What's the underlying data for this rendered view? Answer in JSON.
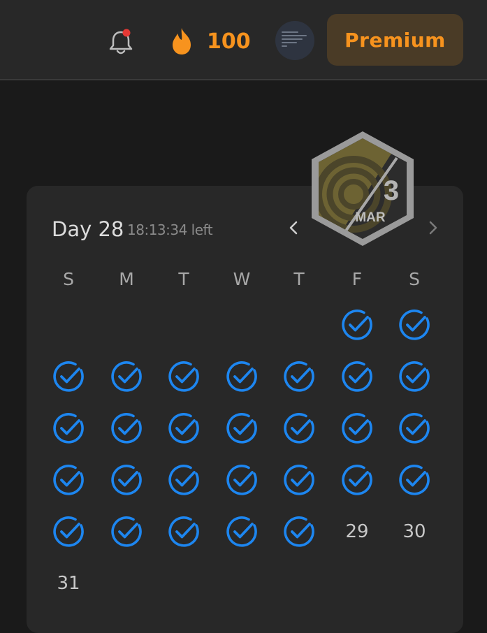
{
  "header": {
    "notification_icon": "bell-icon",
    "streak_icon": "flame-icon",
    "streak_count": "100",
    "premium_label": "Premium",
    "colors": {
      "accent": "#f7931e",
      "premium_bg": "#4a3b26"
    }
  },
  "calendar": {
    "day_label": "Day 28",
    "time_left": "18:13:34 left",
    "badge": {
      "day": "3",
      "month": "MAR"
    },
    "weekdays": [
      "S",
      "M",
      "T",
      "W",
      "T",
      "F",
      "S"
    ],
    "check_color": "#1d86f0",
    "days": [
      {
        "date": 1,
        "done": true
      },
      {
        "date": 2,
        "done": true
      },
      {
        "date": 3,
        "done": true
      },
      {
        "date": 4,
        "done": true
      },
      {
        "date": 5,
        "done": true
      },
      {
        "date": 6,
        "done": true
      },
      {
        "date": 7,
        "done": true
      },
      {
        "date": 8,
        "done": true
      },
      {
        "date": 9,
        "done": true
      },
      {
        "date": 10,
        "done": true
      },
      {
        "date": 11,
        "done": true
      },
      {
        "date": 12,
        "done": true
      },
      {
        "date": 13,
        "done": true
      },
      {
        "date": 14,
        "done": true
      },
      {
        "date": 15,
        "done": true
      },
      {
        "date": 16,
        "done": true
      },
      {
        "date": 17,
        "done": true
      },
      {
        "date": 18,
        "done": true
      },
      {
        "date": 19,
        "done": true
      },
      {
        "date": 20,
        "done": true
      },
      {
        "date": 21,
        "done": true
      },
      {
        "date": 22,
        "done": true
      },
      {
        "date": 23,
        "done": true
      },
      {
        "date": 24,
        "done": true
      },
      {
        "date": 25,
        "done": true
      },
      {
        "date": 26,
        "done": true
      },
      {
        "date": 27,
        "done": true
      },
      {
        "date": 28,
        "done": true
      },
      {
        "date": 29,
        "done": false,
        "label": "29"
      },
      {
        "date": 30,
        "done": false,
        "label": "30"
      },
      {
        "date": 31,
        "done": false,
        "label": "31"
      }
    ]
  }
}
